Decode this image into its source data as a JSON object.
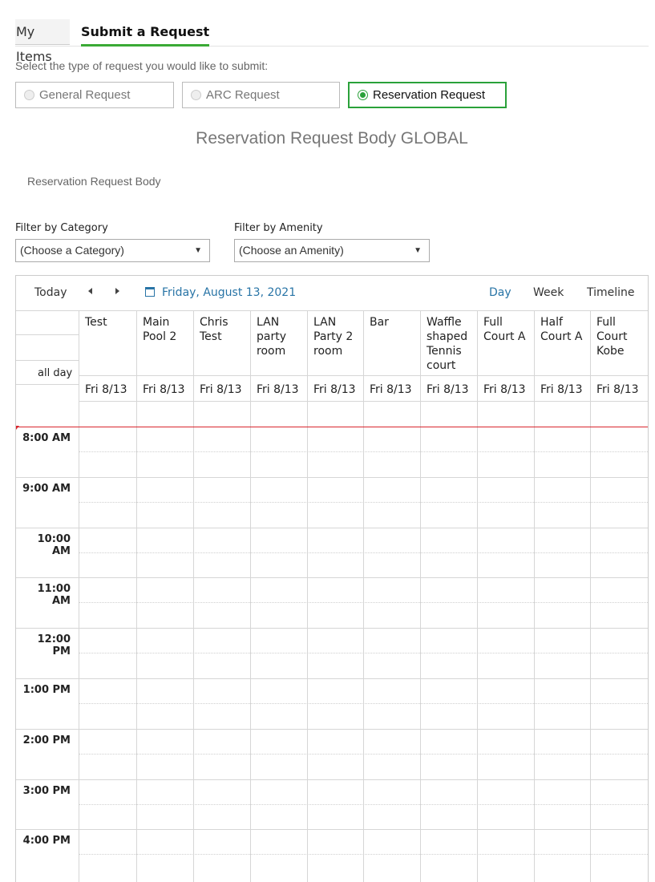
{
  "tabs": [
    {
      "label": "My Items"
    },
    {
      "label": "Submit a Request"
    }
  ],
  "prompt": "Select the type of request you would like to submit:",
  "request_types": [
    {
      "label": "General Request",
      "selected": false
    },
    {
      "label": "ARC Request",
      "selected": false
    },
    {
      "label": "Reservation Request",
      "selected": true
    }
  ],
  "global_title": "Reservation Request Body GLOBAL",
  "body_title": "Reservation Request Body",
  "filters": {
    "category_label": "Filter by Category",
    "category_value": "(Choose a Category)",
    "amenity_label": "Filter by Amenity",
    "amenity_value": "(Choose an Amenity)"
  },
  "calendar": {
    "today_label": "Today",
    "current_date": "Friday, August 13, 2021",
    "views": [
      "Day",
      "Week",
      "Timeline"
    ],
    "active_view": "Day",
    "all_day_label": "all day",
    "columns": [
      {
        "name": "Test",
        "date": "Fri 8/13"
      },
      {
        "name": "Main Pool 2",
        "date": "Fri 8/13"
      },
      {
        "name": "Chris Test",
        "date": "Fri 8/13"
      },
      {
        "name": "LAN party room",
        "date": "Fri 8/13"
      },
      {
        "name": "LAN Party 2 room",
        "date": "Fri 8/13"
      },
      {
        "name": "Bar",
        "date": "Fri 8/13"
      },
      {
        "name": "Waffle shaped Tennis court",
        "date": "Fri 8/13"
      },
      {
        "name": "Full Court A",
        "date": "Fri 8/13"
      },
      {
        "name": "Half Court A",
        "date": "Fri 8/13"
      },
      {
        "name": "Full Court Kobe",
        "date": "Fri 8/13"
      }
    ],
    "times": [
      "8:00 AM",
      "9:00 AM",
      "10:00 AM",
      "11:00 AM",
      "12:00 PM",
      "1:00 PM",
      "2:00 PM",
      "3:00 PM",
      "4:00 PM"
    ],
    "colors": {
      "accent": "#3aaa35",
      "link": "#2874a6",
      "now_line": "#d9262e"
    }
  }
}
